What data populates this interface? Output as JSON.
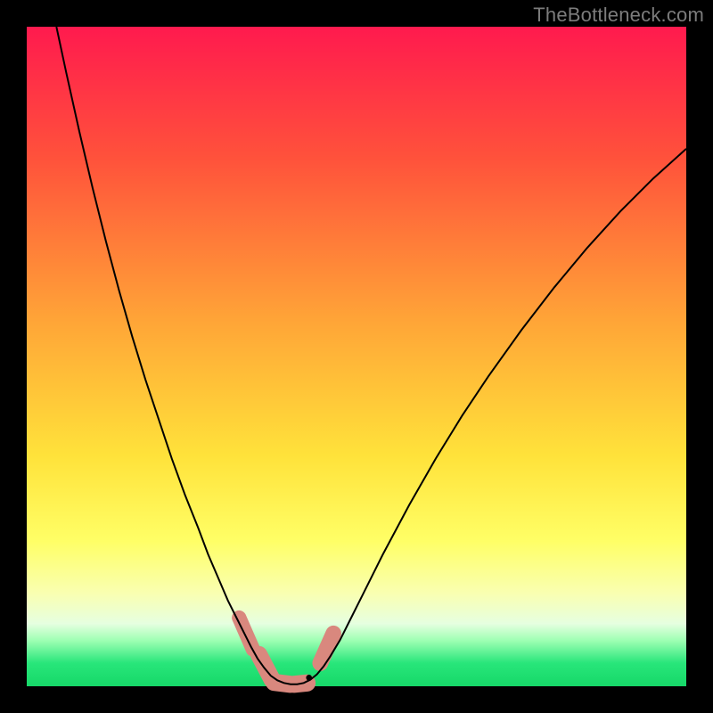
{
  "attribution": "TheBottleneck.com",
  "chart_data": {
    "type": "line",
    "title": "",
    "xlabel": "",
    "ylabel": "",
    "xlim": [
      0,
      100
    ],
    "ylim": [
      0,
      100
    ],
    "grid": false,
    "legend": false,
    "gradient_stops": [
      {
        "offset": 0.0,
        "color": "#ff1a4e"
      },
      {
        "offset": 0.2,
        "color": "#ff523b"
      },
      {
        "offset": 0.45,
        "color": "#ffa637"
      },
      {
        "offset": 0.65,
        "color": "#ffe23a"
      },
      {
        "offset": 0.78,
        "color": "#ffff66"
      },
      {
        "offset": 0.86,
        "color": "#f9ffb2"
      },
      {
        "offset": 0.905,
        "color": "#e6ffe0"
      },
      {
        "offset": 0.93,
        "color": "#a0ffb4"
      },
      {
        "offset": 0.965,
        "color": "#28e67a"
      },
      {
        "offset": 1.0,
        "color": "#16d868"
      }
    ],
    "series": [
      {
        "name": "bottleneck-curve",
        "stroke": "#000000",
        "stroke_width": 2,
        "points": [
          {
            "x": 4.5,
            "y": 100.0
          },
          {
            "x": 6.0,
            "y": 93.0
          },
          {
            "x": 8.0,
            "y": 84.0
          },
          {
            "x": 10.0,
            "y": 75.5
          },
          {
            "x": 12.0,
            "y": 67.5
          },
          {
            "x": 14.0,
            "y": 60.0
          },
          {
            "x": 16.0,
            "y": 53.0
          },
          {
            "x": 18.0,
            "y": 46.5
          },
          {
            "x": 20.0,
            "y": 40.5
          },
          {
            "x": 22.0,
            "y": 34.5
          },
          {
            "x": 24.0,
            "y": 29.0
          },
          {
            "x": 26.0,
            "y": 24.0
          },
          {
            "x": 27.5,
            "y": 20.0
          },
          {
            "x": 29.0,
            "y": 16.5
          },
          {
            "x": 30.5,
            "y": 13.0
          },
          {
            "x": 32.0,
            "y": 10.0
          },
          {
            "x": 33.0,
            "y": 8.0
          },
          {
            "x": 34.0,
            "y": 6.0
          },
          {
            "x": 35.0,
            "y": 4.2
          },
          {
            "x": 36.0,
            "y": 2.8
          },
          {
            "x": 37.0,
            "y": 1.6
          },
          {
            "x": 38.0,
            "y": 0.9
          },
          {
            "x": 39.0,
            "y": 0.5
          },
          {
            "x": 40.0,
            "y": 0.3
          },
          {
            "x": 41.0,
            "y": 0.3
          },
          {
            "x": 42.0,
            "y": 0.5
          },
          {
            "x": 43.0,
            "y": 1.0
          },
          {
            "x": 44.0,
            "y": 1.8
          },
          {
            "x": 45.0,
            "y": 3.0
          },
          {
            "x": 46.0,
            "y": 4.5
          },
          {
            "x": 47.5,
            "y": 7.0
          },
          {
            "x": 49.0,
            "y": 10.0
          },
          {
            "x": 51.0,
            "y": 14.0
          },
          {
            "x": 54.0,
            "y": 20.0
          },
          {
            "x": 58.0,
            "y": 27.5
          },
          {
            "x": 62.0,
            "y": 34.5
          },
          {
            "x": 66.0,
            "y": 41.0
          },
          {
            "x": 70.0,
            "y": 47.0
          },
          {
            "x": 75.0,
            "y": 54.0
          },
          {
            "x": 80.0,
            "y": 60.5
          },
          {
            "x": 85.0,
            "y": 66.5
          },
          {
            "x": 90.0,
            "y": 72.0
          },
          {
            "x": 95.0,
            "y": 77.0
          },
          {
            "x": 100.0,
            "y": 81.5
          }
        ]
      }
    ],
    "annotations": [
      {
        "name": "marker-left-arm-top",
        "shape": "capsule",
        "color": "#d9887e",
        "x1": 32.2,
        "y1": 10.4,
        "x2": 34.3,
        "y2": 5.6,
        "width": 2.2
      },
      {
        "name": "marker-left-arm-bottom",
        "shape": "capsule",
        "color": "#d9887e",
        "x1": 35.2,
        "y1": 4.8,
        "x2": 37.2,
        "y2": 1.0,
        "width": 2.6
      },
      {
        "name": "marker-bottom-1",
        "shape": "capsule",
        "color": "#d9887e",
        "x1": 37.5,
        "y1": 0.6,
        "x2": 40.0,
        "y2": 0.3,
        "width": 2.6
      },
      {
        "name": "marker-bottom-2",
        "shape": "capsule",
        "color": "#d9887e",
        "x1": 40.5,
        "y1": 0.3,
        "x2": 42.5,
        "y2": 0.5,
        "width": 2.6
      },
      {
        "name": "marker-right-arm",
        "shape": "capsule",
        "color": "#d9887e",
        "x1": 44.5,
        "y1": 3.5,
        "x2": 46.5,
        "y2": 8.0,
        "width": 2.4
      },
      {
        "name": "marker-min-dot",
        "shape": "dot",
        "color": "#000000",
        "x": 42.8,
        "y": 1.3,
        "r": 0.45
      }
    ]
  }
}
